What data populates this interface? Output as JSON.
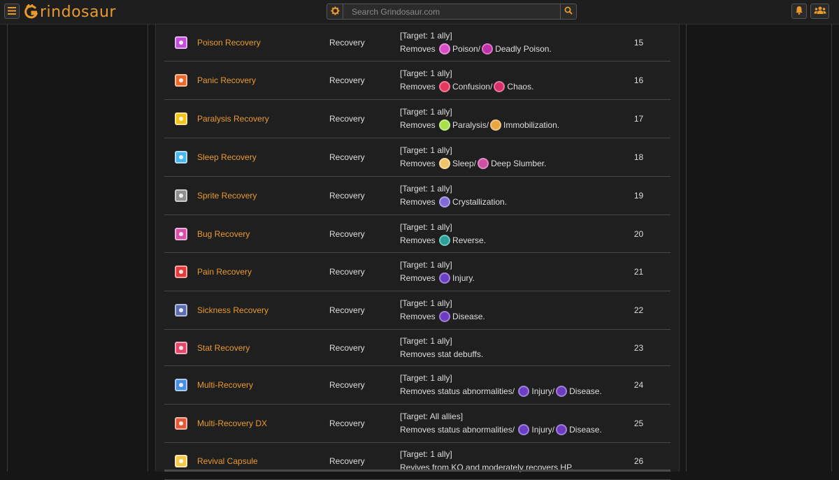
{
  "header": {
    "logo_text": "rindosaur",
    "search_placeholder": "Search Grindosaur.com",
    "accent_color": "#e89a2e"
  },
  "icons": {
    "menu": "hamburger-icon",
    "logo_mark": "dinosaur-g-icon",
    "settings": "gear-icon",
    "search": "search-icon",
    "notifications": "bell-icon",
    "community": "group-icon"
  },
  "rows": [
    {
      "name": "Poison Recovery",
      "icon": "poison-recovery-icon",
      "icon_color": "#c04fd6",
      "category": "Recovery",
      "target": "[Target: 1 ally]",
      "effects": [
        {
          "text": "Removes"
        },
        {
          "icon": "poison-icon",
          "color": "#d94cc8",
          "text": "Poison/"
        },
        {
          "icon": "deadly-poison-icon",
          "color": "#c02fa8",
          "text": "Deadly Poison."
        }
      ],
      "level": "15"
    },
    {
      "name": "Panic Recovery",
      "icon": "panic-recovery-icon",
      "icon_color": "#e86a2a",
      "category": "Recovery",
      "target": "[Target: 1 ally]",
      "effects": [
        {
          "text": "Removes"
        },
        {
          "icon": "confusion-icon",
          "color": "#e5375b",
          "text": "Confusion/"
        },
        {
          "icon": "chaos-icon",
          "color": "#d82e6a",
          "text": "Chaos."
        }
      ],
      "level": "16"
    },
    {
      "name": "Paralysis Recovery",
      "icon": "paralysis-recovery-icon",
      "icon_color": "#f0c419",
      "category": "Recovery",
      "target": "[Target: 1 ally]",
      "effects": [
        {
          "text": "Removes"
        },
        {
          "icon": "paralysis-icon",
          "color": "#a7e04a",
          "text": "Paralysis/"
        },
        {
          "icon": "immobilization-icon",
          "color": "#e9a640",
          "text": "Immobilization."
        }
      ],
      "level": "17"
    },
    {
      "name": "Sleep Recovery",
      "icon": "sleep-recovery-icon",
      "icon_color": "#49b7e8",
      "category": "Recovery",
      "target": "[Target: 1 ally]",
      "effects": [
        {
          "text": "Removes"
        },
        {
          "icon": "sleep-icon",
          "color": "#f1c46a",
          "text": "Sleep/"
        },
        {
          "icon": "deep-slumber-icon",
          "color": "#cf4fa3",
          "text": "Deep Slumber."
        }
      ],
      "level": "18"
    },
    {
      "name": "Sprite Recovery",
      "icon": "sprite-recovery-icon",
      "icon_color": "#8f8f8f",
      "category": "Recovery",
      "target": "[Target: 1 ally]",
      "effects": [
        {
          "text": "Removes"
        },
        {
          "icon": "crystallization-icon",
          "color": "#7f6ad8",
          "text": "Crystallization."
        }
      ],
      "level": "19"
    },
    {
      "name": "Bug Recovery",
      "icon": "bug-recovery-icon",
      "icon_color": "#d64fa8",
      "category": "Recovery",
      "target": "[Target: 1 ally]",
      "effects": [
        {
          "text": "Removes"
        },
        {
          "icon": "reverse-icon",
          "color": "#2aa39a",
          "text": "Reverse."
        }
      ],
      "level": "20"
    },
    {
      "name": "Pain Recovery",
      "icon": "pain-recovery-icon",
      "icon_color": "#e23a3a",
      "category": "Recovery",
      "target": "[Target: 1 ally]",
      "effects": [
        {
          "text": "Removes"
        },
        {
          "icon": "injury-icon",
          "color": "#6b3fc4",
          "text": "Injury."
        }
      ],
      "level": "21"
    },
    {
      "name": "Sickness Recovery",
      "icon": "sickness-recovery-icon",
      "icon_color": "#5a6bb0",
      "category": "Recovery",
      "target": "[Target: 1 ally]",
      "effects": [
        {
          "text": "Removes"
        },
        {
          "icon": "disease-icon",
          "color": "#6d3bc0",
          "text": "Disease."
        }
      ],
      "level": "22"
    },
    {
      "name": "Stat Recovery",
      "icon": "stat-recovery-icon",
      "icon_color": "#e0486c",
      "category": "Recovery",
      "target": "[Target: 1 ally]",
      "effects": [
        {
          "text": "Removes stat debuffs."
        }
      ],
      "level": "23"
    },
    {
      "name": "Multi-Recovery",
      "icon": "multi-recovery-icon",
      "icon_color": "#4a8ee0",
      "category": "Recovery",
      "target": "[Target: 1 ally]",
      "effects": [
        {
          "text": "Removes status abnormalities/"
        },
        {
          "icon": "injury-icon",
          "color": "#6b3fc4",
          "text": "Injury/"
        },
        {
          "icon": "disease-icon",
          "color": "#6d3bc0",
          "text": "Disease."
        }
      ],
      "level": "24"
    },
    {
      "name": "Multi-Recovery DX",
      "icon": "multi-recovery-dx-icon",
      "icon_color": "#e05a3a",
      "category": "Recovery",
      "target": "[Target: All allies]",
      "effects": [
        {
          "text": "Removes status abnormalities/"
        },
        {
          "icon": "injury-icon",
          "color": "#6b3fc4",
          "text": "Injury/"
        },
        {
          "icon": "disease-icon",
          "color": "#6d3bc0",
          "text": "Disease."
        }
      ],
      "level": "25"
    },
    {
      "name": "Revival Capsule",
      "icon": "revival-capsule-icon",
      "icon_color": "#f2c94c",
      "category": "Recovery",
      "target": "[Target: 1 ally]",
      "effects": [
        {
          "text": "Revives from KO and moderately recovers HP."
        }
      ],
      "level": "26"
    }
  ]
}
